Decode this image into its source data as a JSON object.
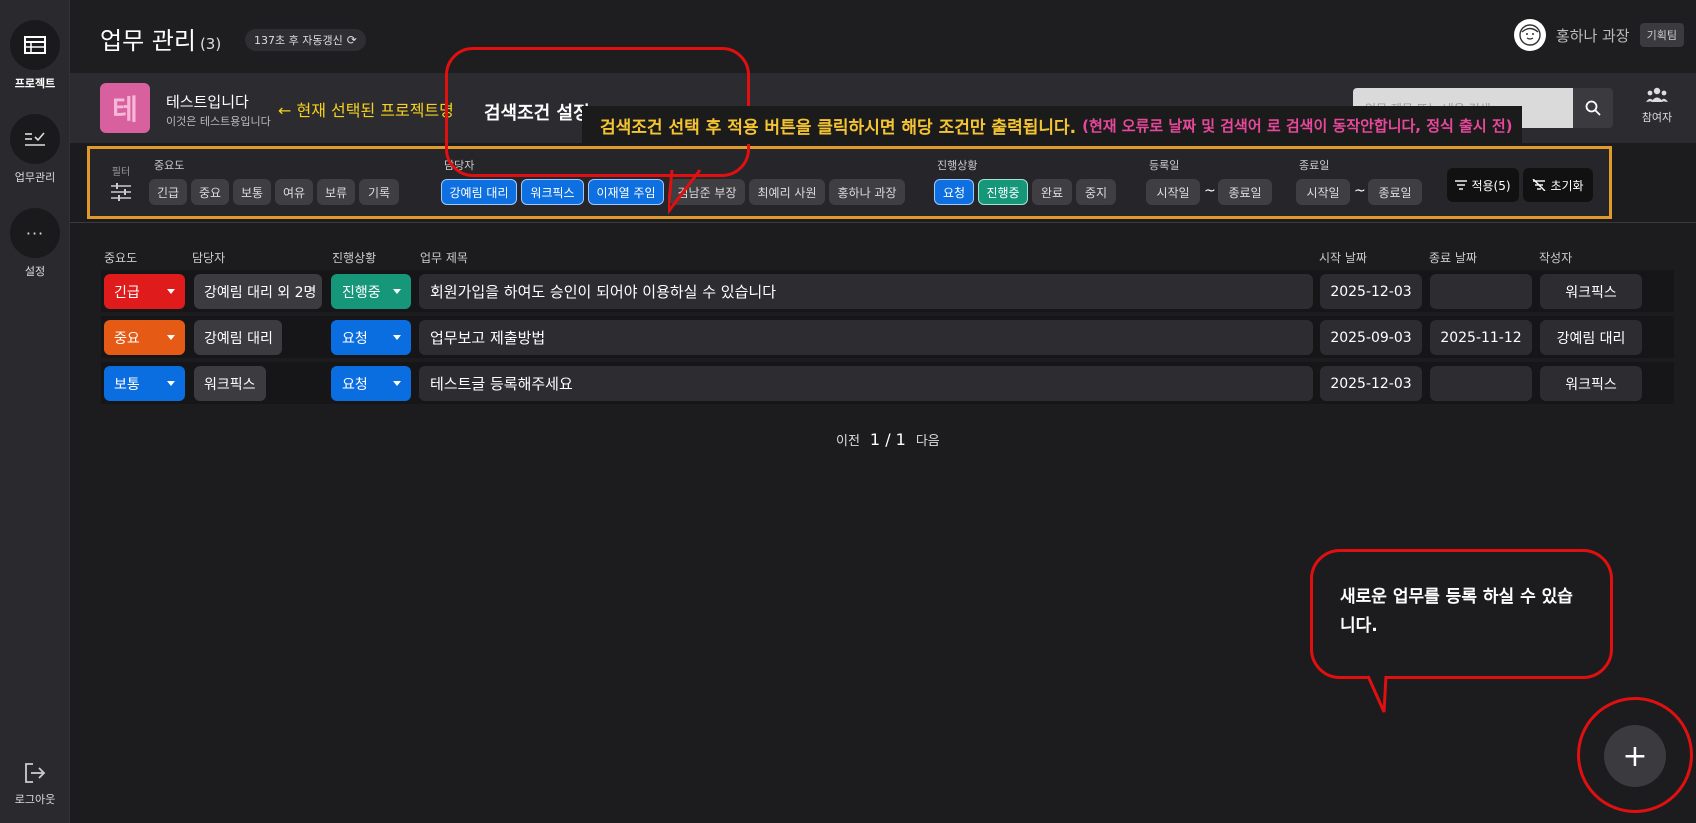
{
  "sidebar": {
    "items": [
      {
        "label": "프로젝트",
        "icon": "table-icon"
      },
      {
        "label": "업무관리",
        "icon": "checklist-icon"
      },
      {
        "label": "설정",
        "icon": "more-icon"
      }
    ],
    "logout": "로그아웃"
  },
  "header": {
    "title": "업무 관리",
    "count": "(3)",
    "refresh": "137초 후 자동갱신",
    "user_name": "홍하나 과장",
    "dept": "기획팀"
  },
  "project": {
    "initial": "테",
    "name": "테스트입니다",
    "desc": "이것은 테스트용입니다",
    "note": "← 현재 선택된 프로젝트명",
    "color": "#d9609f"
  },
  "search": {
    "placeholder": "업무 제목 또는 내용 검색"
  },
  "participants_label": "참여자",
  "filter": {
    "label": "필터",
    "importance": {
      "label": "중요도",
      "options": [
        "긴급",
        "중요",
        "보통",
        "여유",
        "보류",
        "기록"
      ]
    },
    "assignee": {
      "label": "담당자",
      "options": [
        "강예림 대리",
        "워크픽스",
        "이재열 주임",
        "김남준 부장",
        "최예리 사원",
        "홍하나 과장"
      ],
      "selected": [
        "강예림 대리",
        "워크픽스",
        "이재열 주임"
      ]
    },
    "status": {
      "label": "진행상황",
      "options": [
        "요청",
        "진행중",
        "완료",
        "중지"
      ],
      "selected": [
        "요청",
        "진행중"
      ]
    },
    "reg_date": {
      "label": "등록일",
      "start": "시작일",
      "end": "종료일",
      "sep": "~"
    },
    "end_date": {
      "label": "종료일",
      "start": "시작일",
      "end": "종료일",
      "sep": "~"
    },
    "apply": "적용(5)",
    "reset": "초기화"
  },
  "table": {
    "headers": [
      "중요도",
      "담당자",
      "진행상황",
      "업무 제목",
      "시작 날짜",
      "종료 날짜",
      "작성자"
    ],
    "rows": [
      {
        "importance": "긴급",
        "assignee": "강예림 대리 외 2명",
        "status": "진행중",
        "title": "회원가입을 하여도 승인이 되어야 이용하실 수 있습니다",
        "start": "2025-12-03",
        "end": "",
        "author": "워크픽스"
      },
      {
        "importance": "중요",
        "assignee": "강예림 대리",
        "status": "요청",
        "title": "업무보고 제출방법",
        "start": "2025-09-03",
        "end": "2025-11-12",
        "author": "강예림 대리"
      },
      {
        "importance": "보통",
        "assignee": "워크픽스",
        "status": "요청",
        "title": "테스트글 등록해주세요",
        "start": "2025-12-03",
        "end": "",
        "author": "워크픽스"
      }
    ]
  },
  "pager": {
    "prev": "이전",
    "page": "1 / 1",
    "next": "다음"
  },
  "annotations": {
    "search_title": "검색조건 설정",
    "help_main": "검색조건 선택 후 적용 버튼을 클릭하시면 해당 조건만 출력됩니다.",
    "help_sub": "(현재 오류로 날짜 및 검색어 로 검색이 동작안합니다, 정식 출시 전)",
    "new_task": "새로운 업무를 등록 하실 수 있습니다."
  },
  "fab": "+",
  "colors": {
    "urgent": "#e01b1b",
    "important": "#e55b16",
    "normal": "#0b6ee0",
    "in_progress": "#16977a",
    "request": "#0b6ee0",
    "annotation_red": "#e01010",
    "filter_border": "#e09a2c"
  }
}
